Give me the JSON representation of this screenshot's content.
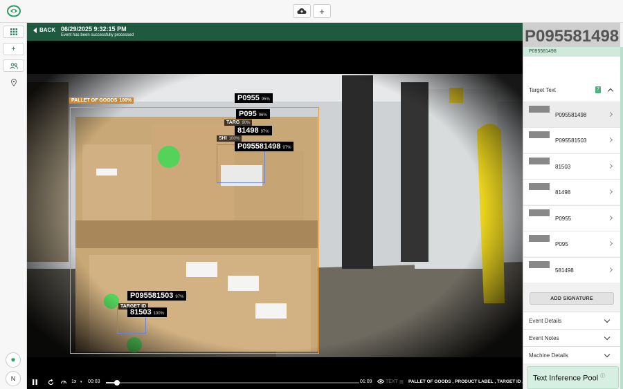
{
  "topbar": {
    "cloud_icon": "cloud-upload-icon",
    "plus_label": "+"
  },
  "rail": {
    "add_label": "+",
    "round_1": "✹",
    "round_2": "N"
  },
  "event": {
    "back_label": "BACK",
    "datetime": "06/29/2025 9:32:15 PM",
    "status": "Event has been successfully processed"
  },
  "detections": [
    {
      "text": "PALLET OF GOODS",
      "conf": "100%"
    },
    {
      "text": "P0955",
      "conf": "95%"
    },
    {
      "text": "P095",
      "conf": "96%"
    },
    {
      "text": "81498",
      "conf": "97%"
    },
    {
      "text": "P095581498",
      "conf": "97%"
    },
    {
      "text": "P095581503",
      "conf": "97%"
    },
    {
      "text": "81503",
      "conf": "100%"
    },
    {
      "text": "TARGET ID",
      "conf": ""
    },
    {
      "text": "SHI",
      "conf": "100%"
    },
    {
      "text": "TARG",
      "conf": "90%"
    }
  ],
  "player": {
    "current_time": "00:03",
    "end_time": "01:09",
    "speed": "1x",
    "progress_fraction": 0.045,
    "text_toggle": "TEXT",
    "classes": "PALLET OF GOODS , PRODUCT LABEL , TARGET ID , SHIPPING"
  },
  "panel": {
    "thumb_text": "P095581498",
    "thumb_id": "P095581498",
    "target_text_label": "Target Text",
    "target_count": "7",
    "signatures": [
      {
        "text": "P095581498"
      },
      {
        "text": "P095581503"
      },
      {
        "text": "81503"
      },
      {
        "text": "81498"
      },
      {
        "text": "P0955"
      },
      {
        "text": "P095"
      },
      {
        "text": "581498"
      }
    ],
    "add_signature": "ADD SIGNATURE",
    "sections": [
      "Event Details",
      "Event Notes",
      "Machine Details"
    ],
    "pool_label": "Text Inference Pool",
    "pool_info": "ⓘ"
  },
  "colors": {
    "header_green": "#1f5a40",
    "accent_green": "#4caf7d",
    "box_orange": "#e39a3c",
    "box_blue": "#6b84d6"
  }
}
